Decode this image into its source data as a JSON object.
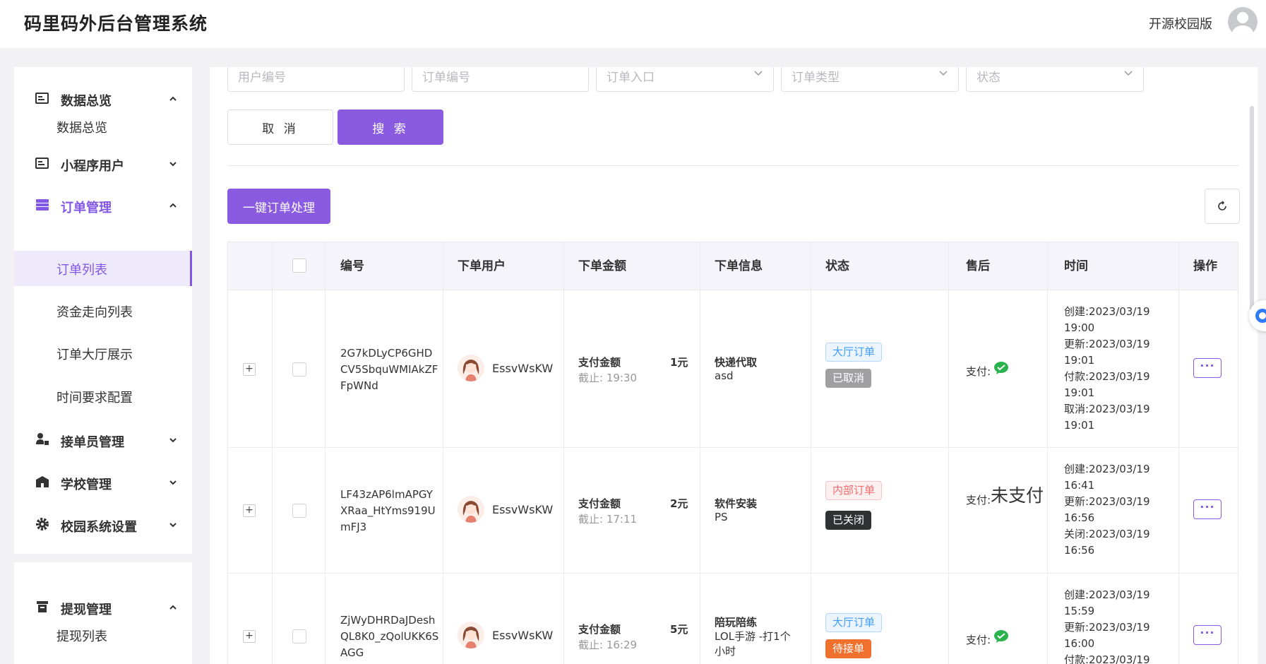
{
  "header": {
    "title": "码里码外后台管理系统",
    "edition": "开源校园版"
  },
  "sidebar": {
    "groups": [
      {
        "label": "数据总览",
        "icon": "dashboard-icon",
        "expanded": true,
        "items": [
          "数据总览"
        ]
      },
      {
        "label": "小程序用户",
        "icon": "users-icon",
        "expanded": false,
        "items": []
      },
      {
        "label": "订单管理",
        "icon": "orders-icon",
        "expanded": true,
        "active": true,
        "items": [
          "订单列表",
          "资金走向列表",
          "订单大厅展示",
          "时间要求配置"
        ]
      },
      {
        "label": "接单员管理",
        "icon": "courier-icon",
        "expanded": false,
        "items": []
      },
      {
        "label": "学校管理",
        "icon": "school-icon",
        "expanded": false,
        "items": []
      },
      {
        "label": "校园系统设置",
        "icon": "gear-icon",
        "expanded": false,
        "items": []
      },
      {
        "label": "提现管理",
        "icon": "withdraw-icon",
        "expanded": true,
        "items": [
          "提现列表"
        ]
      }
    ],
    "active_item": "订单列表"
  },
  "filters": {
    "user_no": "用户编号",
    "order_no": "订单编号",
    "order_entry": "订单入口",
    "order_type": "订单类型",
    "status": "状态"
  },
  "buttons": {
    "cancel": "取 消",
    "search": "搜 索",
    "batch": "一键订单处理"
  },
  "table": {
    "columns": [
      "编号",
      "下单用户",
      "下单金额",
      "下单信息",
      "状态",
      "售后",
      "时间",
      "操作"
    ],
    "rows": [
      {
        "order_no": "2G7kDLyCP6GHDCV5SbquWMIAkZFFpWNd",
        "user": "EssvWsKW",
        "amount_label": "支付金额",
        "amount": "1元",
        "deadline": "截止: 19:30",
        "info_title": "快递代取",
        "info_desc": "asd",
        "tag1": "大厅订单",
        "tag2": "已取消",
        "pay_label": "支付:",
        "pay_value": "",
        "times": [
          "创建:2023/03/19 19:00",
          "更新:2023/03/19 19:01",
          "付款:2023/03/19 19:01",
          "取消:2023/03/19 19:01"
        ]
      },
      {
        "order_no": "LF43zAP6lmAPGYXRaa_HtYms919UmFJ3",
        "user": "EssvWsKW",
        "amount_label": "支付金额",
        "amount": "2元",
        "deadline": "截止: 17:11",
        "info_title": "软件安装",
        "info_desc": "PS",
        "tag1": "内部订单",
        "tag2": "已关闭",
        "pay_label": "支付:",
        "pay_value": "未支付",
        "times": [
          "创建:2023/03/19 16:41",
          "更新:2023/03/19 16:56",
          "关闭:2023/03/19 16:56"
        ]
      },
      {
        "order_no": "ZjWyDHRDaJDeshQL8K0_zQolUKK6SAGG",
        "user": "EssvWsKW",
        "amount_label": "支付金额",
        "amount": "5元",
        "deadline": "截止: 16:29",
        "info_title": "陪玩陪练",
        "info_desc": "LOL手游 -打1个小时",
        "tag1": "大厅订单",
        "tag2": "待接单",
        "pay_label": "支付:",
        "pay_value": "",
        "times": [
          "创建:2023/03/19 15:59",
          "更新:2023/03/19 16:00",
          "付款:2023/03/19"
        ]
      }
    ]
  },
  "colors": {
    "accent": "#8a5be0",
    "wechat": "#2ab24c",
    "tag_blue": "#409eff",
    "tag_red": "#f56c6c",
    "tag_orange": "#f0702e"
  }
}
